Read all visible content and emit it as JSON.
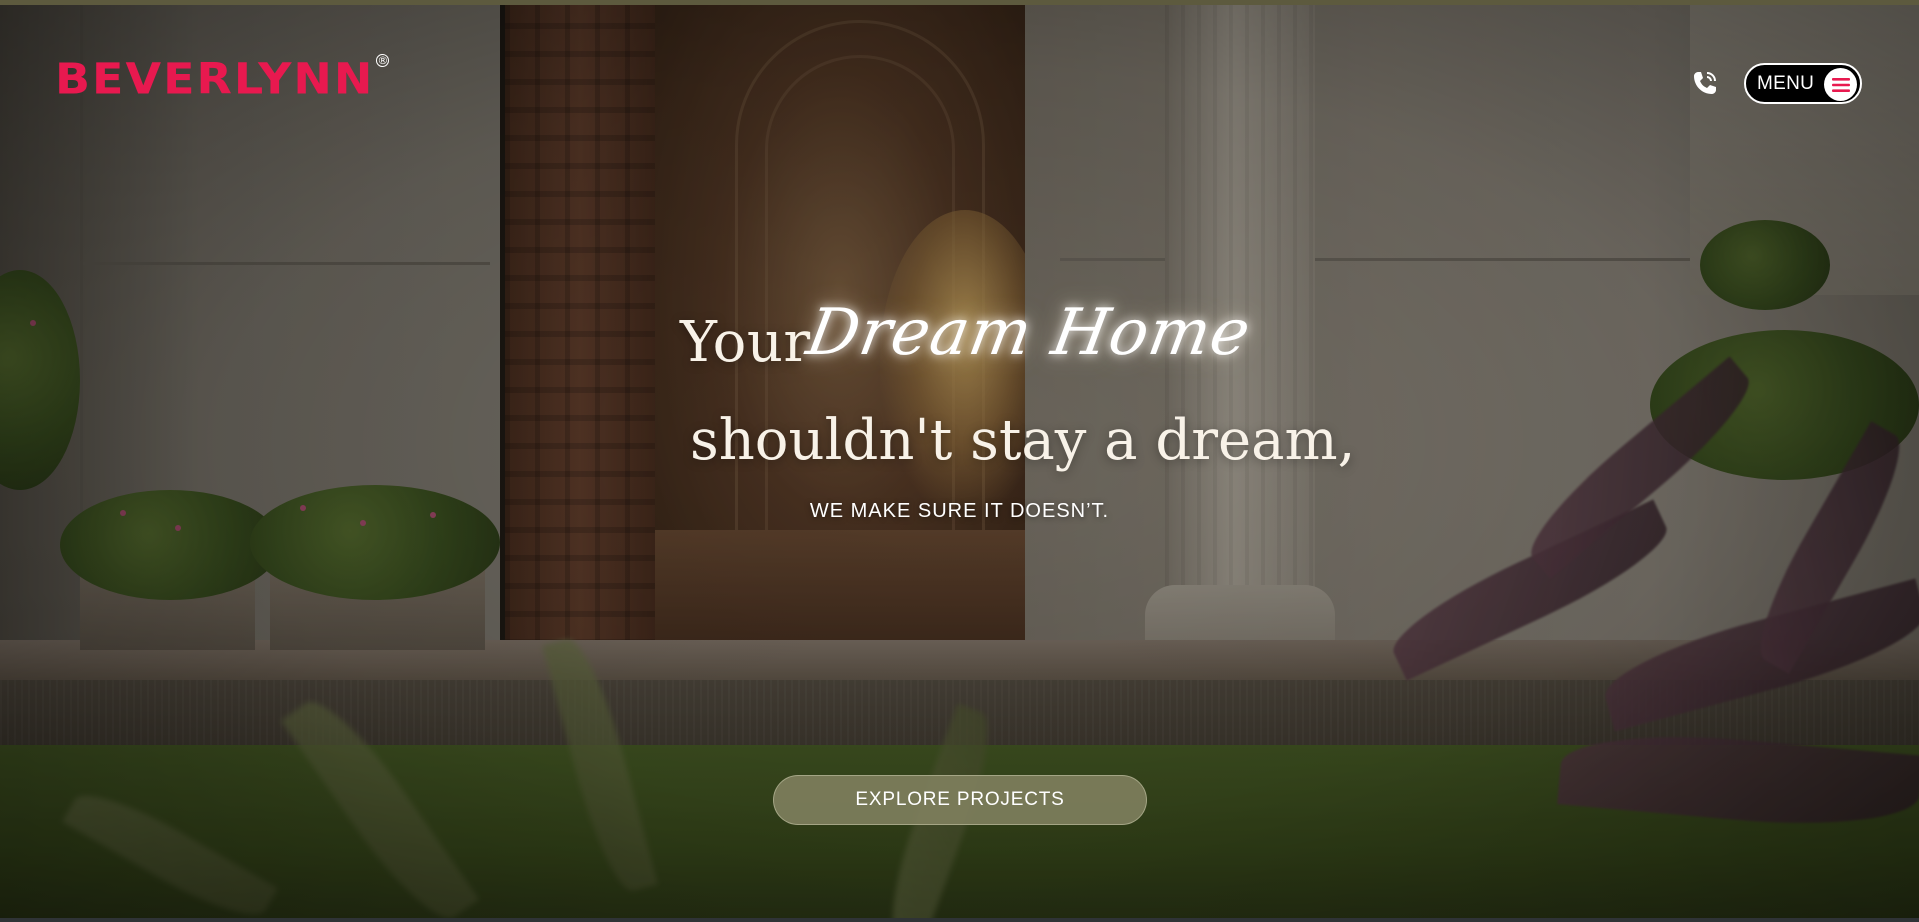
{
  "header": {
    "brand_name": "BEVERLYNN",
    "registered_mark": "®",
    "phone_icon": "phone-call-icon",
    "menu_label": "MENU",
    "menu_icon": "hamburger-icon"
  },
  "hero": {
    "headline_word_1": "Your",
    "headline_script": "Dream Home",
    "headline_line_2": "shouldn't stay a dream,",
    "subheading": "WE MAKE SURE IT DOESN’T.",
    "cta_label": "EXPLORE PROJECTS"
  },
  "colors": {
    "brand_accent": "#e8194f",
    "menu_background": "#000000",
    "cta_background": "#80805e",
    "text_light": "#ffffff"
  }
}
